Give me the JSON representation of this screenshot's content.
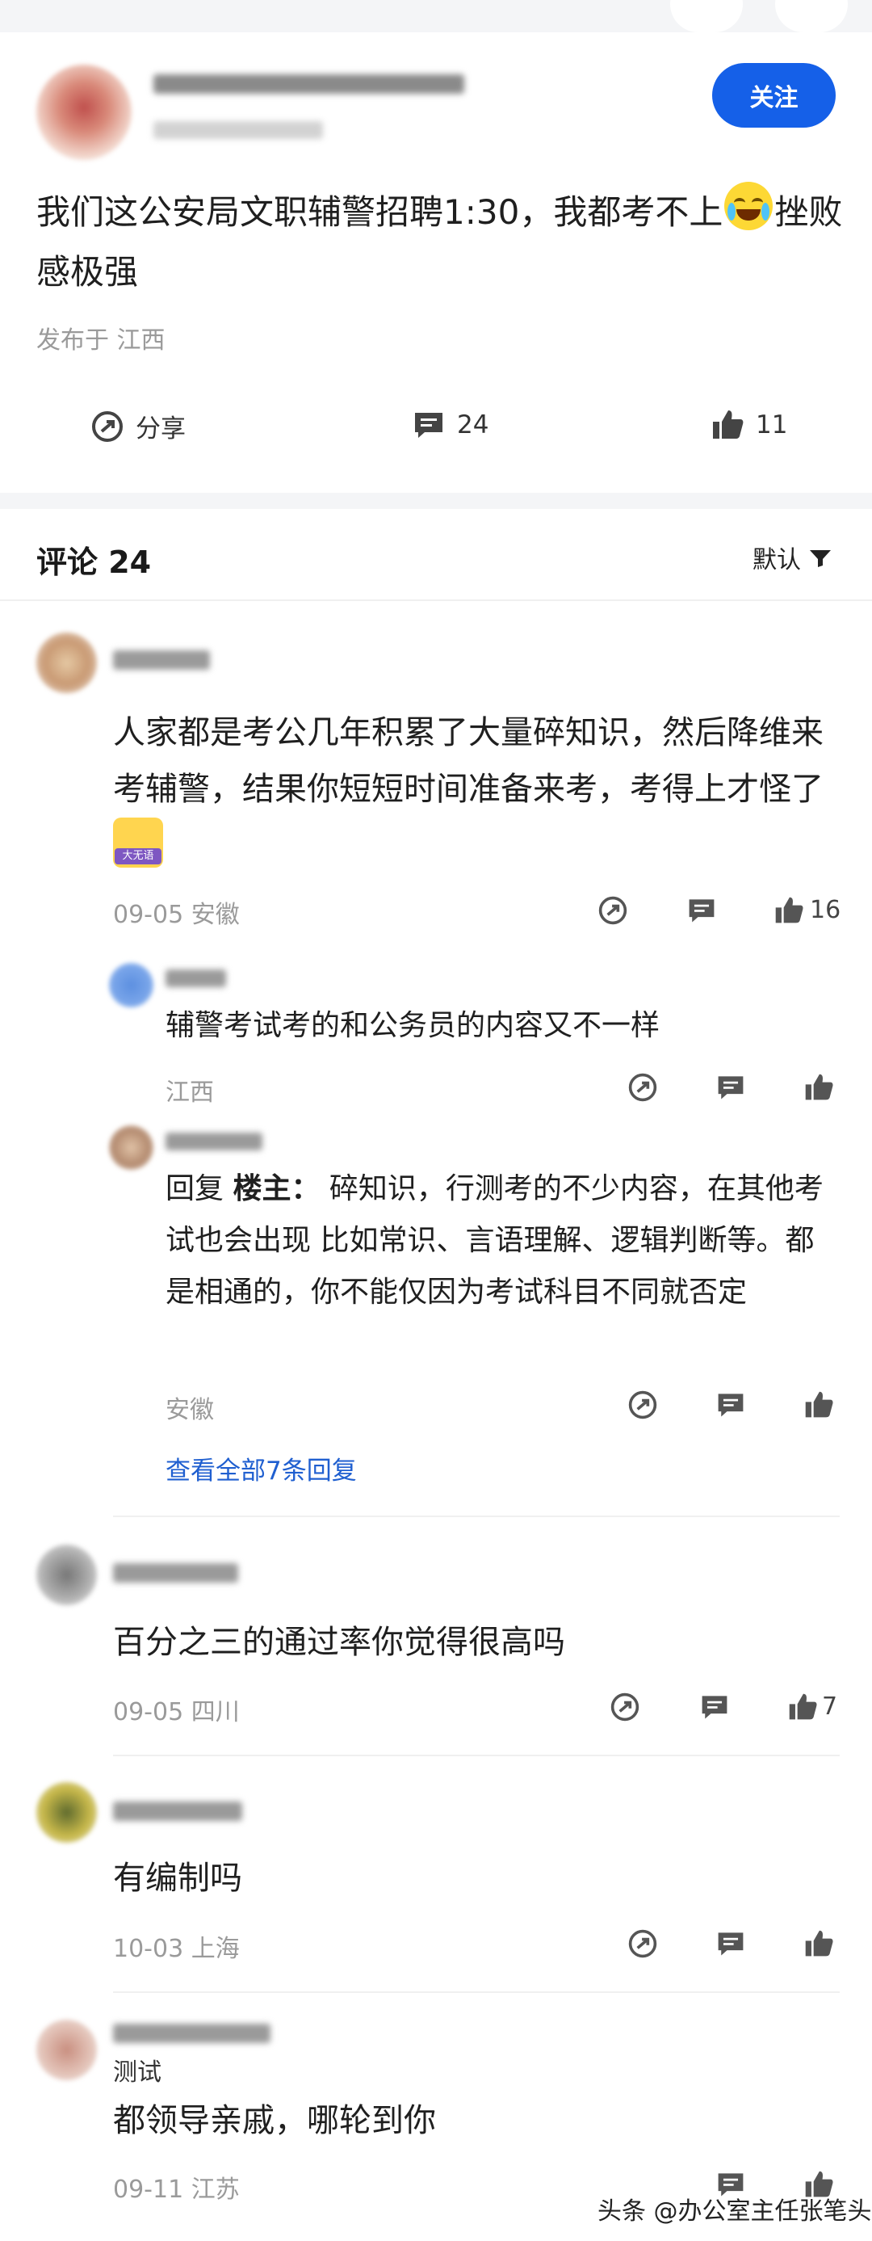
{
  "post": {
    "follow_label": "关注",
    "text": "我们这公安局文职辅警招聘1:30，我都考不上",
    "text_after_emoji": "挫败感极强",
    "emoji_icon": "tears-of-joy-icon",
    "location": "发布于 江西",
    "share_label": "分享",
    "comment_count": "24",
    "like_count": "11"
  },
  "comments_header": {
    "title": "评论 24",
    "sort_label": "默认"
  },
  "comments": [
    {
      "text": "人家都是考公几年积累了大量碎知识，然后降维来考辅警，结果你短短时间准备来考，考得上才怪了",
      "sticker_label": "大无语",
      "meta": "09-05 安徽",
      "likes": "16",
      "replies": [
        {
          "text": "辅警考试考的和公务员的内容又不一样",
          "meta": "江西"
        },
        {
          "reply_prefix": "回复 ",
          "reply_target": "楼主：",
          "text": " 碎知识，行测考的不少内容，在其他考试也会出现 比如常识、言语理解、逻辑判断等。都是相通的，你不能仅因为考试科目不同就否定",
          "meta": "安徽"
        }
      ],
      "view_more": "查看全部7条回复"
    },
    {
      "text": "百分之三的通过率你觉得很高吗",
      "meta": "09-05 四川",
      "likes": "7"
    },
    {
      "text": "有编制吗",
      "meta": "10-03 上海",
      "likes": ""
    },
    {
      "tag": "测试",
      "text": "都领导亲戚，哪轮到你",
      "meta": "09-11 江苏",
      "likes": ""
    }
  ],
  "watermark": "头条 @办公室主任张笔头",
  "colors": {
    "accent": "#1560e8",
    "meta": "#9a9a9a",
    "link": "#1f5fd0"
  }
}
